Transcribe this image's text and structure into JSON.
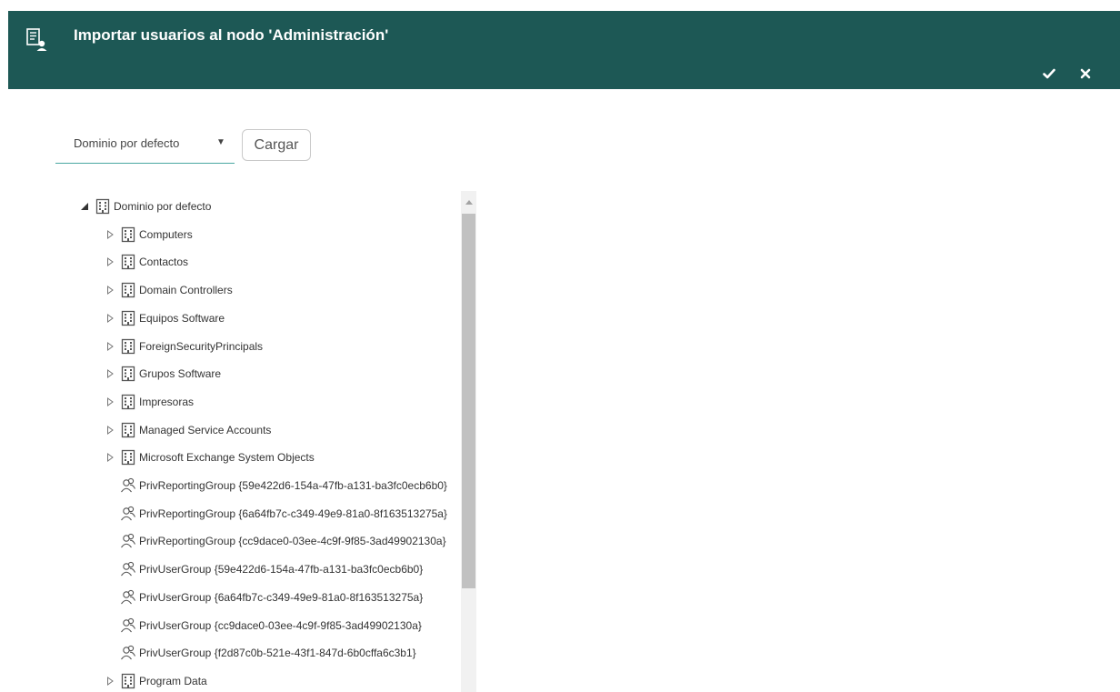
{
  "header": {
    "title": "Importar usuarios al nodo 'Administración'",
    "icon": "user-directory-icon",
    "confirm_icon": "checkmark-icon",
    "close_icon": "close-icon",
    "background_color": "#1d5855"
  },
  "domain_select": {
    "selected": "Dominio por defecto",
    "arrow": "▼"
  },
  "load_button": {
    "label": "Cargar"
  },
  "tree": {
    "root": {
      "label": "Dominio por defecto",
      "expanded": true,
      "icon": "building-icon"
    },
    "items": [
      {
        "label": "Computers",
        "icon": "building-icon",
        "expandable": true
      },
      {
        "label": "Contactos",
        "icon": "building-icon",
        "expandable": true
      },
      {
        "label": "Domain Controllers",
        "icon": "building-icon",
        "expandable": true
      },
      {
        "label": "Equipos Software",
        "icon": "building-icon",
        "expandable": true
      },
      {
        "label": "ForeignSecurityPrincipals",
        "icon": "building-icon",
        "expandable": true
      },
      {
        "label": "Grupos Software",
        "icon": "building-icon",
        "expandable": true
      },
      {
        "label": "Impresoras",
        "icon": "building-icon",
        "expandable": true
      },
      {
        "label": "Managed Service Accounts",
        "icon": "building-icon",
        "expandable": true
      },
      {
        "label": "Microsoft Exchange System Objects",
        "icon": "building-icon",
        "expandable": true
      },
      {
        "label": "PrivReportingGroup {59e422d6-154a-47fb-a131-ba3fc0ecb6b0}",
        "icon": "group-icon",
        "expandable": false
      },
      {
        "label": "PrivReportingGroup {6a64fb7c-c349-49e9-81a0-8f163513275a}",
        "icon": "group-icon",
        "expandable": false
      },
      {
        "label": "PrivReportingGroup {cc9dace0-03ee-4c9f-9f85-3ad49902130a}",
        "icon": "group-icon",
        "expandable": false
      },
      {
        "label": "PrivUserGroup {59e422d6-154a-47fb-a131-ba3fc0ecb6b0}",
        "icon": "group-icon",
        "expandable": false
      },
      {
        "label": "PrivUserGroup {6a64fb7c-c349-49e9-81a0-8f163513275a}",
        "icon": "group-icon",
        "expandable": false
      },
      {
        "label": "PrivUserGroup {cc9dace0-03ee-4c9f-9f85-3ad49902130a}",
        "icon": "group-icon",
        "expandable": false
      },
      {
        "label": "PrivUserGroup {f2d87c0b-521e-43f1-847d-6b0cffa6c3b1}",
        "icon": "group-icon",
        "expandable": false
      },
      {
        "label": "Program Data",
        "icon": "building-icon",
        "expandable": true
      }
    ]
  }
}
